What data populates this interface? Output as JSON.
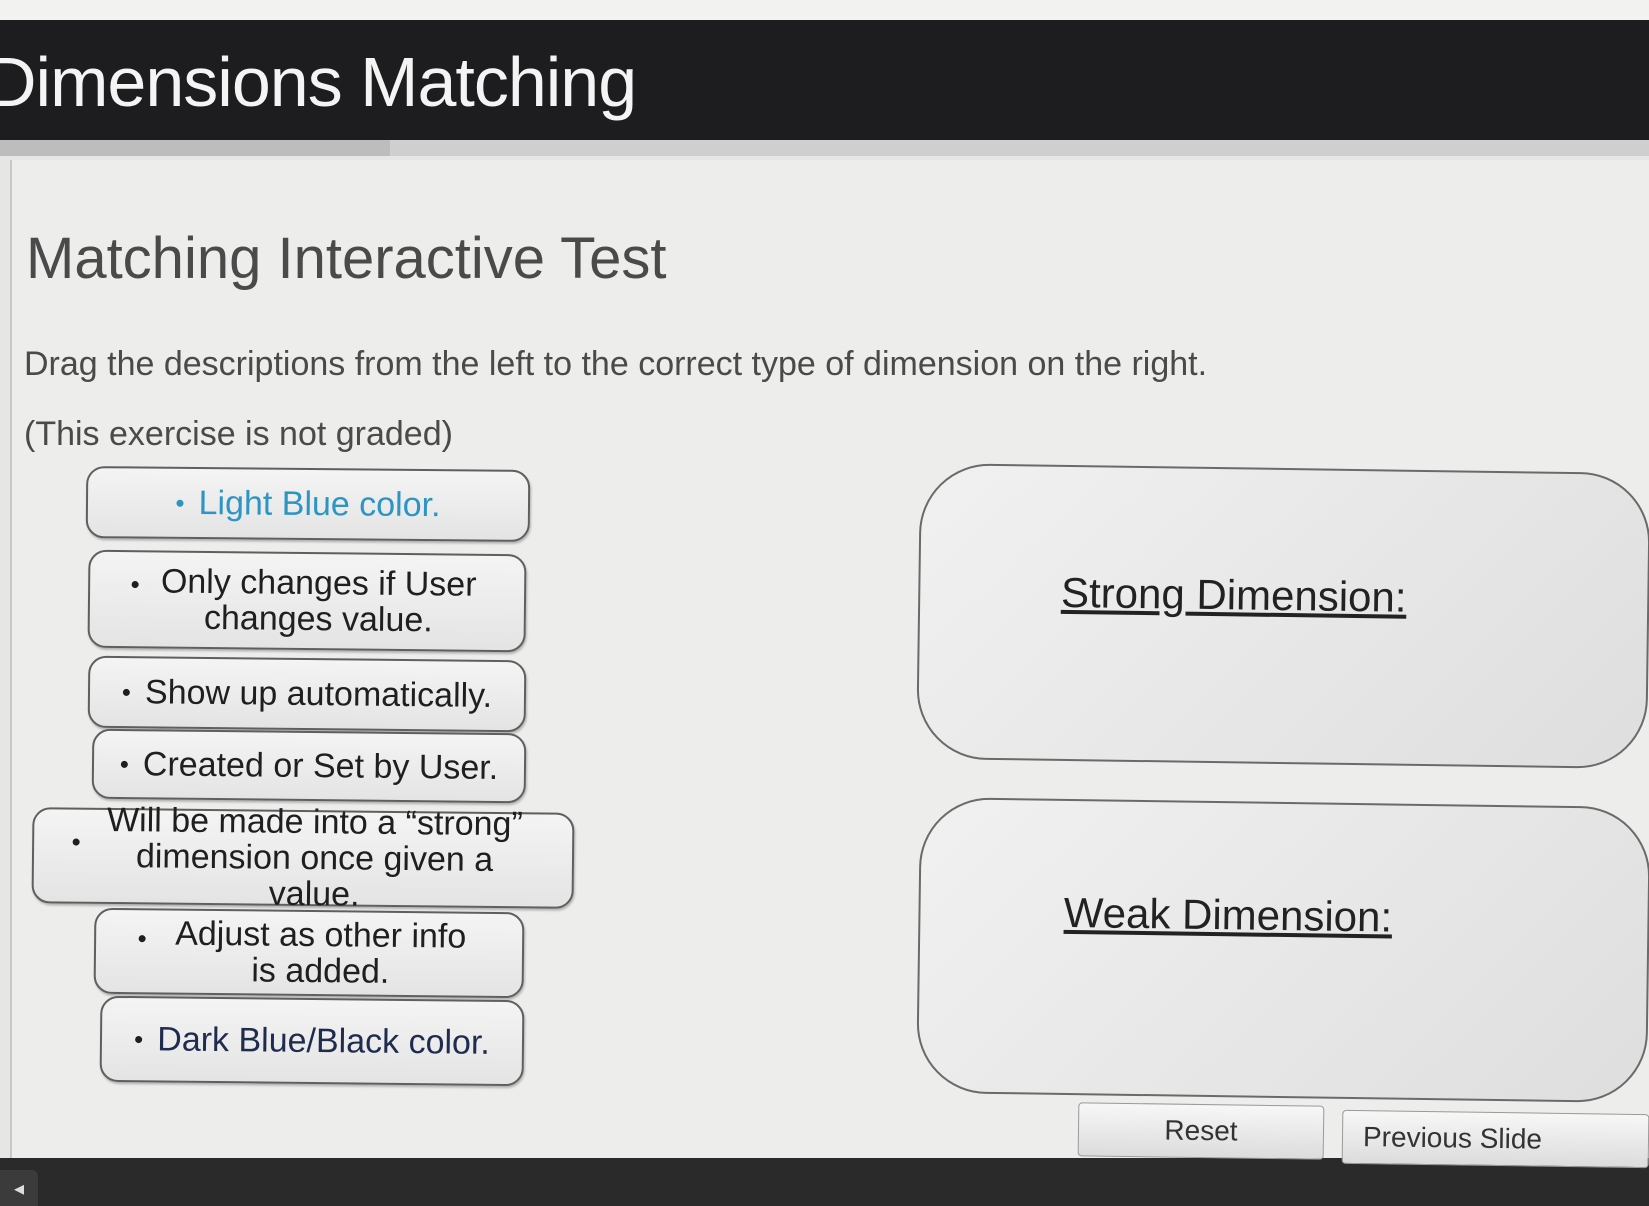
{
  "header": {
    "title": "Dimensions Matching"
  },
  "page": {
    "title": "Matching Interactive Test",
    "instructions": "Drag the descriptions from the left to the correct type of dimension on the right.",
    "note": "(This exercise is not graded)"
  },
  "cards": [
    {
      "text": "Light Blue color."
    },
    {
      "text": "Only changes if User changes value."
    },
    {
      "text": "Show up automatically."
    },
    {
      "text": "Created or Set by User."
    },
    {
      "text": "Will be made into a “strong” dimension once given a value."
    },
    {
      "text": "Adjust as other info is added."
    },
    {
      "text": "Dark Blue/Black color."
    }
  ],
  "targets": {
    "strong": "Strong Dimension:",
    "weak": "Weak Dimension:"
  },
  "footer": {
    "reset": "Reset",
    "previous": "Previous Slide"
  },
  "colors": {
    "header_bg": "#1d1d1f",
    "light_blue_text": "#2c95c4",
    "dark_blue_text": "#1f2c4f"
  }
}
